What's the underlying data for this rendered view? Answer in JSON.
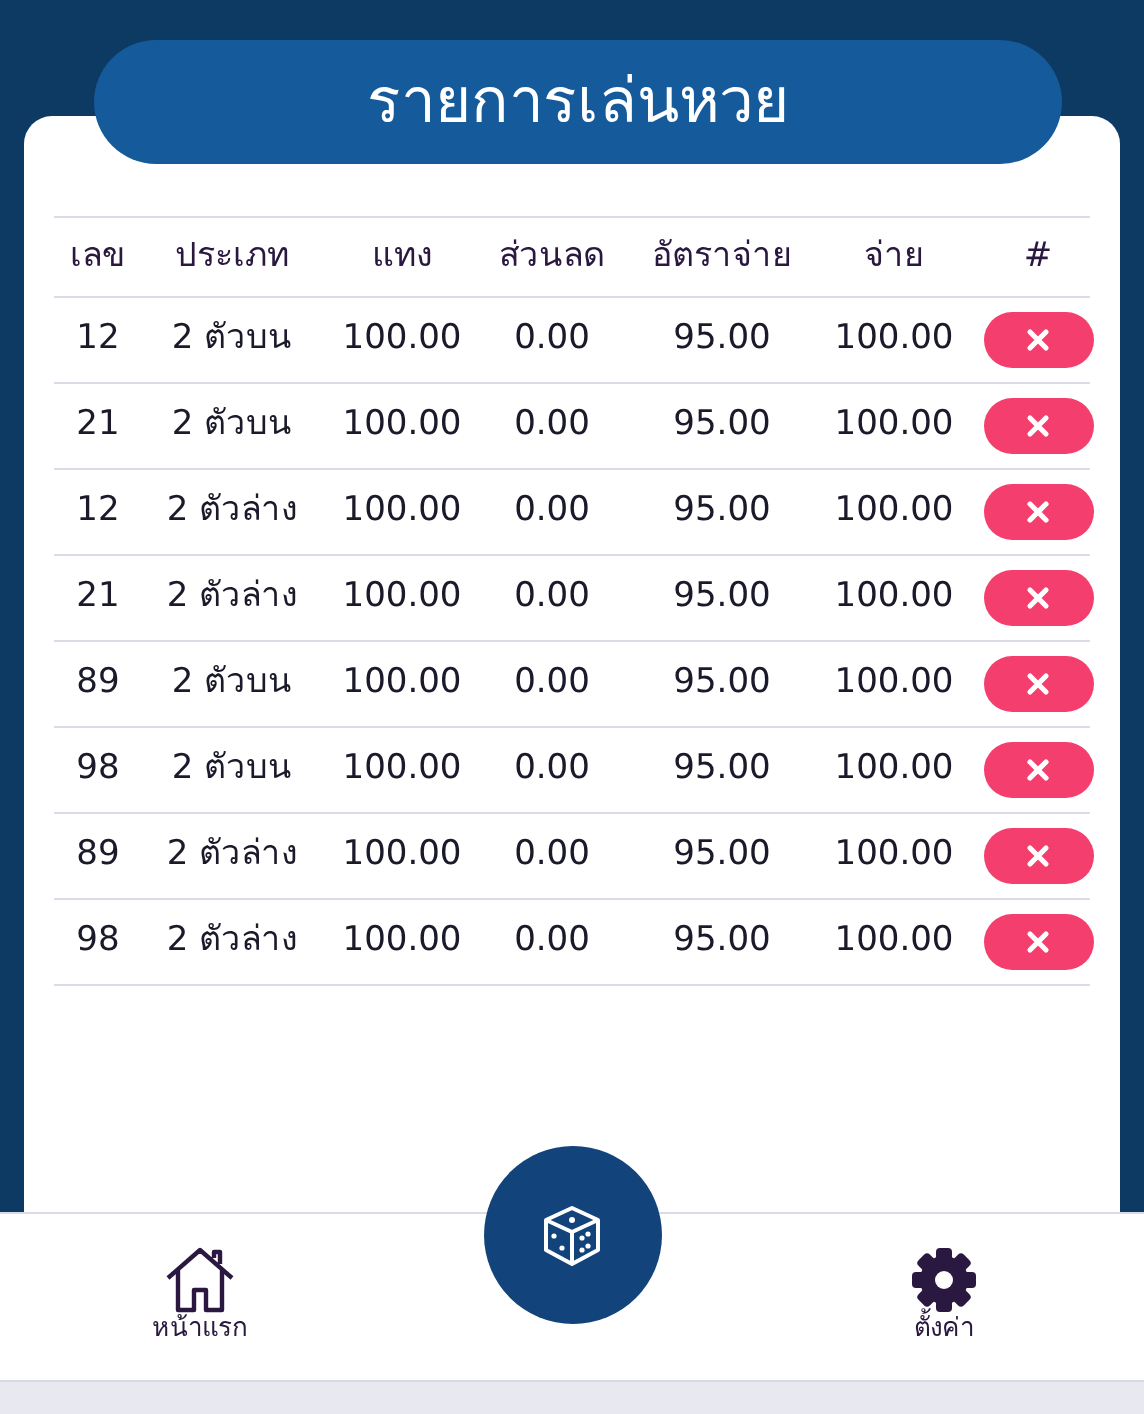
{
  "title": "รายการเล่นหวย",
  "table": {
    "columns": [
      "เลข",
      "ประเภท",
      "แทง",
      "ส่วนลด",
      "อัตราจ่าย",
      "จ่าย",
      "#"
    ],
    "rows": [
      {
        "cells": [
          "12",
          "2 ตัวบน",
          "100.00",
          "0.00",
          "95.00",
          "100.00"
        ]
      },
      {
        "cells": [
          "21",
          "2 ตัวบน",
          "100.00",
          "0.00",
          "95.00",
          "100.00"
        ]
      },
      {
        "cells": [
          "12",
          "2 ตัวล่าง",
          "100.00",
          "0.00",
          "95.00",
          "100.00"
        ]
      },
      {
        "cells": [
          "21",
          "2 ตัวล่าง",
          "100.00",
          "0.00",
          "95.00",
          "100.00"
        ]
      },
      {
        "cells": [
          "89",
          "2 ตัวบน",
          "100.00",
          "0.00",
          "95.00",
          "100.00"
        ]
      },
      {
        "cells": [
          "98",
          "2 ตัวบน",
          "100.00",
          "0.00",
          "95.00",
          "100.00"
        ]
      },
      {
        "cells": [
          "89",
          "2 ตัวล่าง",
          "100.00",
          "0.00",
          "95.00",
          "100.00"
        ]
      },
      {
        "cells": [
          "98",
          "2 ตัวล่าง",
          "100.00",
          "0.00",
          "95.00",
          "100.00"
        ]
      }
    ]
  },
  "bottom_nav": [
    {
      "kind": "home",
      "label": "หน้าแรก"
    },
    {
      "kind": "dice"
    },
    {
      "kind": "settings",
      "label": "ตั้งค่า"
    }
  ]
}
